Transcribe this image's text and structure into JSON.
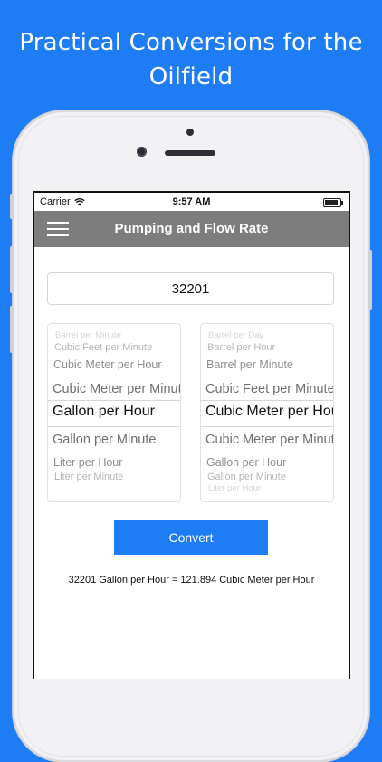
{
  "promo": {
    "headline_line1": "Practical Conversions for the",
    "headline_line2": "Oilfield"
  },
  "status_bar": {
    "carrier": "Carrier",
    "time": "9:57 AM"
  },
  "nav": {
    "title": "Pumping and Flow Rate"
  },
  "form": {
    "amount_value": "32201",
    "from_picker": {
      "items": [
        "Barrel per Minute",
        "Cubic Feet per Minute",
        "Cubic Meter per Hour",
        "Cubic Meter per Minute",
        "Gallon per Hour",
        "Gallon per Minute",
        "Liter per Hour",
        "Liter per Minute"
      ],
      "selected": "Gallon per Hour"
    },
    "to_picker": {
      "items": [
        "Barrel per Day",
        "Barrel per Hour",
        "Barrel per Minute",
        "Cubic Feet per Minute",
        "Cubic Meter per Hour",
        "Cubic Meter per Minute",
        "Gallon per Hour",
        "Gallon per Minute",
        "Liter per Hour"
      ],
      "selected": "Cubic Meter per Hour"
    },
    "convert_label": "Convert",
    "result_text": "32201 Gallon per Hour = 121.894 Cubic Meter per Hour"
  },
  "colors": {
    "background": "#1e7cf5",
    "nav_bar": "#7d7d7d",
    "button": "#1e7cf5"
  }
}
